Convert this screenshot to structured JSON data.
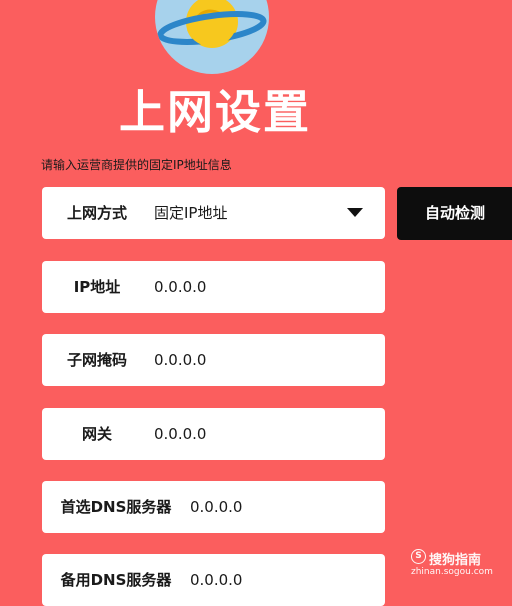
{
  "logo": {
    "icon": "planet-logo-icon",
    "colors": {
      "bg": "#a7d2ec",
      "planet": "#f7c81e",
      "ring": "#2c86c9"
    }
  },
  "title": "上网设置",
  "hint": "请输入运营商提供的固定IP地址信息",
  "fields": [
    {
      "label": "上网方式",
      "value": "固定IP地址",
      "type": "select"
    },
    {
      "label": "IP地址",
      "value": "0.0.0.0",
      "type": "input"
    },
    {
      "label": "子网掩码",
      "value": "0.0.0.0",
      "type": "input"
    },
    {
      "label": "网关",
      "value": "0.0.0.0",
      "type": "input"
    },
    {
      "label": "首选DNS服务器",
      "value": "0.0.0.0",
      "type": "input"
    },
    {
      "label": "备用DNS服务器",
      "value": "0.0.0.0",
      "type": "input"
    }
  ],
  "auto_detect_label": "自动检测",
  "watermark": {
    "brand": "搜狗指南",
    "url": "zhinan.sogou.com",
    "icon_glyph": "S"
  },
  "colors": {
    "background": "#fb5e5e",
    "button": "#0d0d0d",
    "field": "#ffffff"
  }
}
